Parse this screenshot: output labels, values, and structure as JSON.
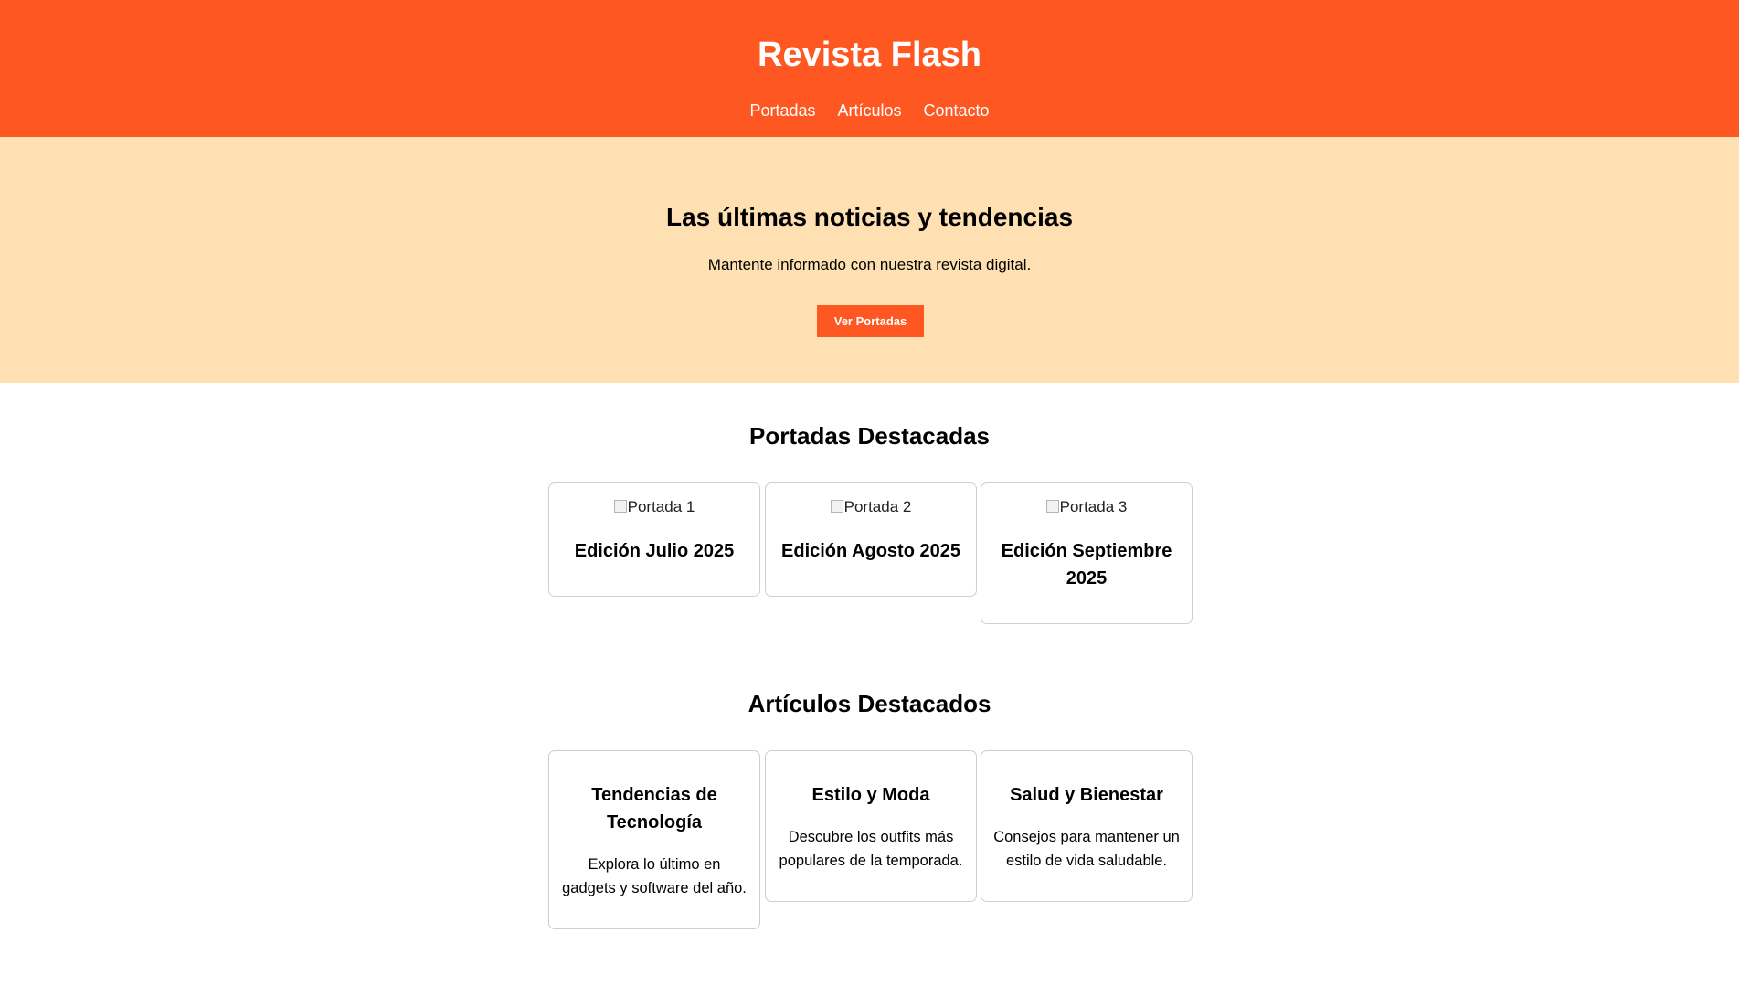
{
  "header": {
    "title": "Revista Flash",
    "nav": [
      "Portadas",
      "Artículos",
      "Contacto"
    ]
  },
  "hero": {
    "title": "Las últimas noticias y tendencias",
    "subtitle": "Mantente informado con nuestra revista digital.",
    "button_label": "Ver Portadas"
  },
  "covers": {
    "title": "Portadas Destacadas",
    "items": [
      {
        "image_alt": "Portada 1",
        "title": "Edición Julio 2025"
      },
      {
        "image_alt": "Portada 2",
        "title": "Edición Agosto 2025"
      },
      {
        "image_alt": "Portada 3",
        "title": "Edición Septiembre 2025"
      }
    ]
  },
  "articles": {
    "title": "Artículos Destacados",
    "items": [
      {
        "title": "Tendencias de Tecnología",
        "description": "Explora lo último en gadgets y software del año."
      },
      {
        "title": "Estilo y Moda",
        "description": "Descubre los outfits más populares de la temporada."
      },
      {
        "title": "Salud y Bienestar",
        "description": "Consejos para mantener un estilo de vida saludable."
      }
    ]
  },
  "colors": {
    "accent": "#ff5722",
    "hero_background": "#ffe0b2"
  }
}
